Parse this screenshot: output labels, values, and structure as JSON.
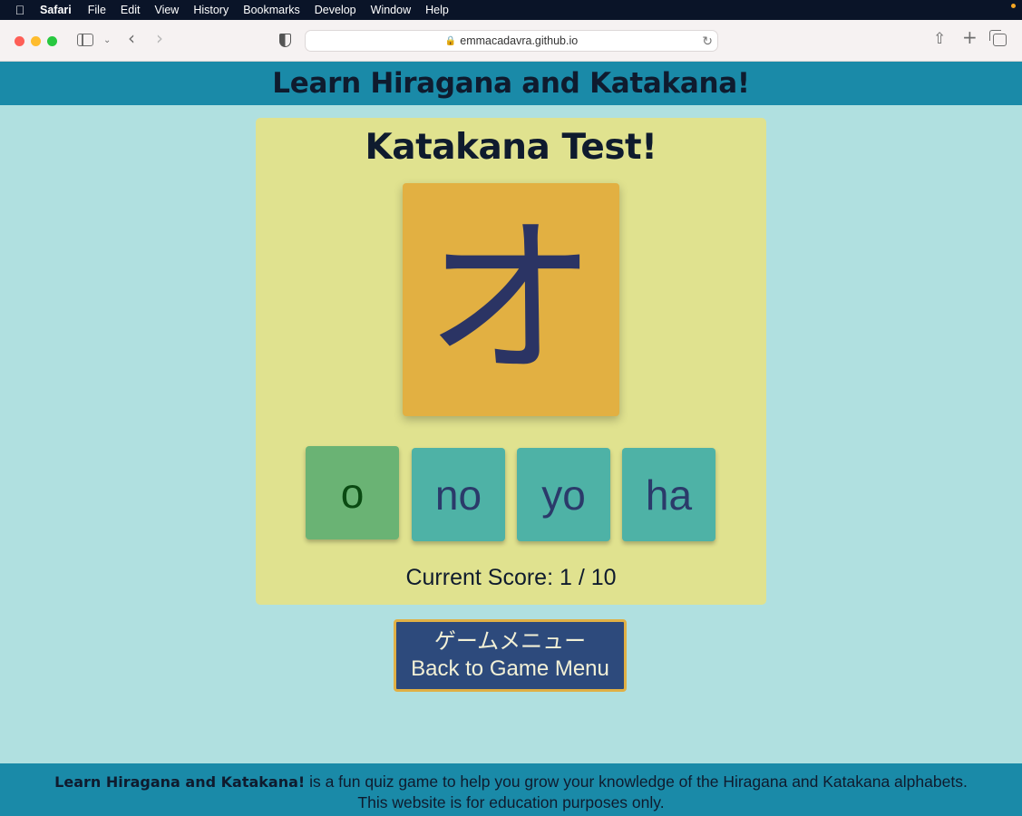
{
  "menubar": {
    "app": "Safari",
    "items": [
      "File",
      "Edit",
      "View",
      "History",
      "Bookmarks",
      "Develop",
      "Window",
      "Help"
    ]
  },
  "browser": {
    "url": "emmacadavra.github.io"
  },
  "site": {
    "title": "Learn Hiragana and Katakana!"
  },
  "quiz": {
    "title": "Katakana Test!",
    "character": "オ",
    "answers": [
      {
        "label": "o",
        "state": "correct"
      },
      {
        "label": "no",
        "state": "default"
      },
      {
        "label": "yo",
        "state": "default"
      },
      {
        "label": "ha",
        "state": "default"
      }
    ],
    "score_text": "Current Score: 1 / 10"
  },
  "menu_button": {
    "japanese": "ゲームメニュー",
    "english": "Back to Game Menu"
  },
  "footer": {
    "brand": "Learn Hiragana and Katakana!",
    "text": " is a fun quiz game to help you grow your knowledge of the Hiragana and Katakana alphabets.",
    "line2": "This website is for education purposes only."
  },
  "colors": {
    "header": "#1a8aa8",
    "page_bg": "#b0e0e0",
    "panel": "#e0e28f",
    "card": "#e2b042",
    "answer": "#4eb2a6",
    "answer_correct": "#6ab374",
    "menu_button": "#2d4a7c"
  }
}
